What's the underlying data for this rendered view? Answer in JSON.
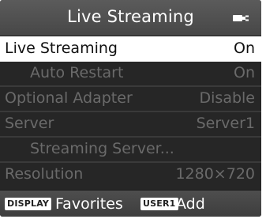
{
  "header": {
    "title": "Live Streaming",
    "status_icon": "power-plug-icon"
  },
  "menu": {
    "items": [
      {
        "label": "Live Streaming",
        "value": "On"
      },
      {
        "label": "Auto Restart",
        "value": "On"
      },
      {
        "label": "Optional Adapter",
        "value": "Disable"
      },
      {
        "label": "Server",
        "value": "Server1"
      },
      {
        "label": "Streaming Server...",
        "value": ""
      },
      {
        "label": "Resolution",
        "value": "1280×720"
      }
    ]
  },
  "footer": {
    "display_button": "DISPLAY",
    "display_action": "Favorites",
    "user1_button": "USER1",
    "user1_action": "Add"
  },
  "colors": {
    "selected_bg": "#ffffff",
    "menu_bg": "#262626",
    "disabled_text": "#6a6a6a"
  }
}
